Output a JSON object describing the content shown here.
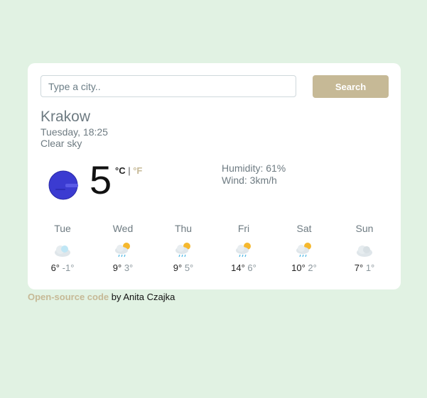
{
  "search": {
    "placeholder": "Type a city..",
    "value": "",
    "button_label": "Search"
  },
  "current": {
    "city": "Krakow",
    "date": "Tuesday, 18:25",
    "description": "Clear sky",
    "temperature": "5",
    "unit_celsius": "°C",
    "unit_separator": "|",
    "unit_fahrenheit": "°F",
    "humidity": "Humidity: 61%",
    "wind": "Wind: 3km/h",
    "icon": "clear-night-icon"
  },
  "forecast": [
    {
      "day": "Tue",
      "icon": "cloud-icon",
      "max": "6°",
      "min": "-1°"
    },
    {
      "day": "Wed",
      "icon": "sun-cloud-rain-icon",
      "max": "9°",
      "min": "3°"
    },
    {
      "day": "Thu",
      "icon": "sun-cloud-rain-icon",
      "max": "9°",
      "min": "5°"
    },
    {
      "day": "Fri",
      "icon": "sun-cloud-rain-icon",
      "max": "14°",
      "min": "6°"
    },
    {
      "day": "Sat",
      "icon": "sun-cloud-rain-icon",
      "max": "10°",
      "min": "2°"
    },
    {
      "day": "Sun",
      "icon": "cloud-icon",
      "max": "7°",
      "min": "1°"
    }
  ],
  "footer": {
    "link_text": "Open-source code",
    "author_text": "by Anita Czajka"
  },
  "colors": {
    "background": "#e1f2e3",
    "accent": "#c6b996",
    "text_muted": "#6e7b82",
    "moon": "#3b3bd1"
  }
}
